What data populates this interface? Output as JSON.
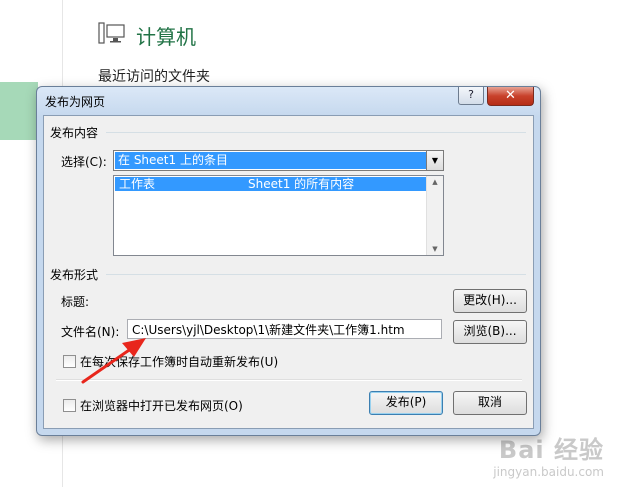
{
  "background": {
    "computer_title": "计算机",
    "recent_folders": "最近访问的文件夹",
    "watermark_main": "Bai 经验",
    "watermark_sub": "jingyan.baidu.com"
  },
  "dialog": {
    "title": "发布为网页",
    "help_label": "?",
    "close_label": "✕",
    "content_section": "发布内容",
    "choose_label": "选择(C):",
    "choose_value": "在 Sheet1 上的条目",
    "list": [
      {
        "type": "工作表",
        "desc": "Sheet1 的所有内容"
      }
    ],
    "format_section": "发布形式",
    "title_label": "标题:",
    "change_button": "更改(H)...",
    "filename_label": "文件名(N):",
    "filename_value": "C:\\Users\\yjl\\Desktop\\1\\新建文件夹\\工作簿1.htm",
    "browse_button": "浏览(B)...",
    "autorepublish_label": "在每次保存工作簿时自动重新发布(U)",
    "open_in_browser_label": "在浏览器中打开已发布网页(O)",
    "publish_button": "发布(P)",
    "cancel_button": "取消"
  },
  "colors": {
    "selection": "#3399ff",
    "annotation_arrow": "#e8261c",
    "excel_green": "#217346"
  }
}
